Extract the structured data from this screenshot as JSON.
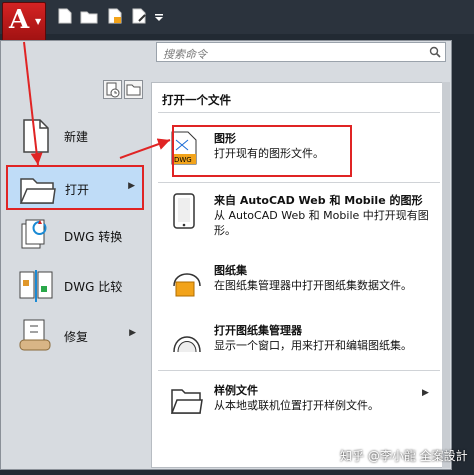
{
  "app": {
    "letter": "A"
  },
  "search": {
    "placeholder": "搜索命令"
  },
  "left": {
    "items": [
      {
        "label": "新建"
      },
      {
        "label": "打开"
      },
      {
        "label": "DWG 转换"
      },
      {
        "label": "DWG 比较"
      },
      {
        "label": "修复"
      }
    ]
  },
  "right": {
    "title": "打开一个文件",
    "items": [
      {
        "title": "图形",
        "desc": "打开现有的图形文件。"
      },
      {
        "title": "来自 AutoCAD Web 和 Mobile 的图形",
        "desc": "从 AutoCAD Web 和 Mobile 中打开现有图形。"
      },
      {
        "title": "图纸集",
        "desc": "在图纸集管理器中打开图纸集数据文件。"
      },
      {
        "title": "打开图纸集管理器",
        "desc": "显示一个窗口，用来打开和编辑图纸集。"
      },
      {
        "title": "样例文件",
        "desc": "从本地或联机位置打开样例文件。"
      }
    ]
  },
  "watermark": "知乎 @李小龍 全案設計",
  "colors": {
    "accent_red": "#e02424",
    "selected_bg": "#bfdcf7",
    "app_red": "#c41c1c"
  }
}
